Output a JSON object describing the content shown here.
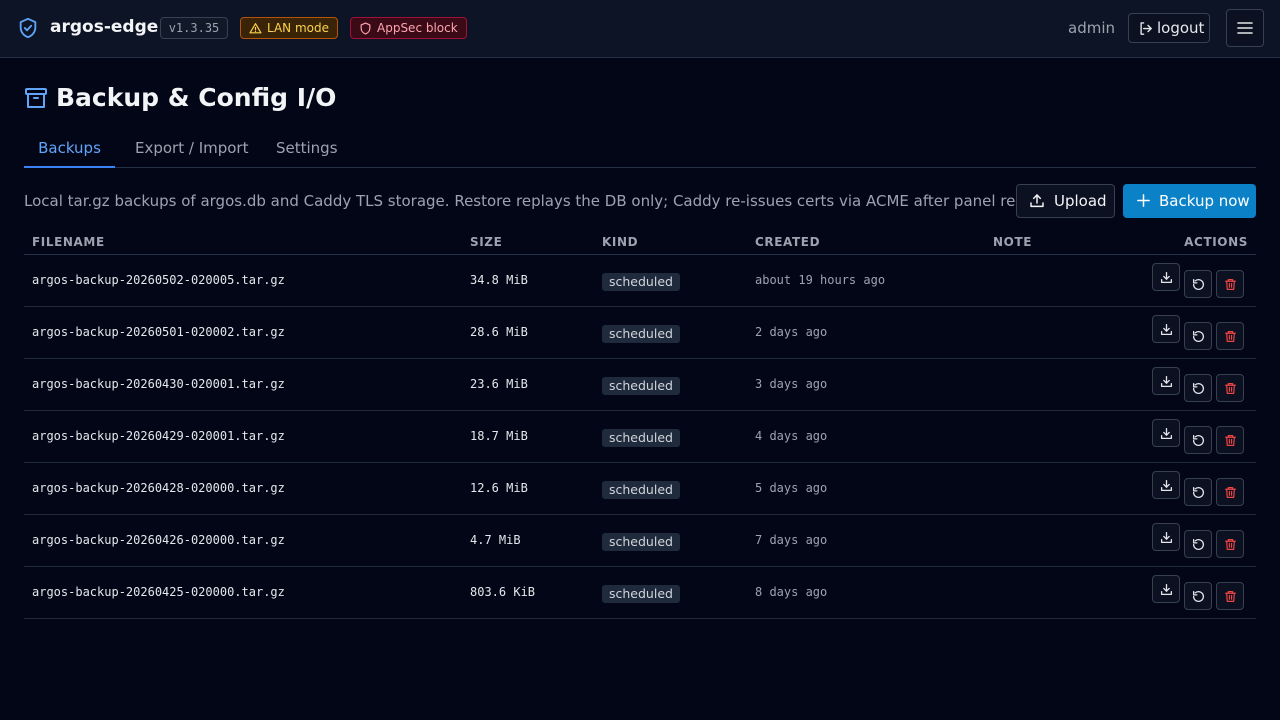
{
  "header": {
    "brand": "argos-edge",
    "version": "v1.3.35",
    "lan_badge": "LAN mode",
    "appsec_badge": "AppSec block",
    "user": "admin",
    "logout_label": "logout",
    "menu_icon": "hamburger-icon"
  },
  "page": {
    "title": "Backup & Config I/O",
    "icon": "archive-icon"
  },
  "tabs": [
    {
      "label": "Backups",
      "active": true
    },
    {
      "label": "Export / Import",
      "active": false
    },
    {
      "label": "Settings",
      "active": false
    }
  ],
  "backups": {
    "description": "Local tar.gz backups of argos.db and Caddy TLS storage. Restore replays the DB only; Caddy re-issues certs via ACME after panel restart.",
    "upload_label": "Upload",
    "backup_now_label": "Backup now",
    "columns": {
      "filename": "FILENAME",
      "size": "SIZE",
      "kind": "KIND",
      "created": "CREATED",
      "note": "NOTE",
      "actions": "ACTIONS"
    },
    "rows": [
      {
        "filename": "argos-backup-20260502-020005.tar.gz",
        "size": "34.8 MiB",
        "kind": "scheduled",
        "created": "about 19 hours ago",
        "note": ""
      },
      {
        "filename": "argos-backup-20260501-020002.tar.gz",
        "size": "28.6 MiB",
        "kind": "scheduled",
        "created": "2 days ago",
        "note": ""
      },
      {
        "filename": "argos-backup-20260430-020001.tar.gz",
        "size": "23.6 MiB",
        "kind": "scheduled",
        "created": "3 days ago",
        "note": ""
      },
      {
        "filename": "argos-backup-20260429-020001.tar.gz",
        "size": "18.7 MiB",
        "kind": "scheduled",
        "created": "4 days ago",
        "note": ""
      },
      {
        "filename": "argos-backup-20260428-020000.tar.gz",
        "size": "12.6 MiB",
        "kind": "scheduled",
        "created": "5 days ago",
        "note": ""
      },
      {
        "filename": "argos-backup-20260426-020000.tar.gz",
        "size": "4.7 MiB",
        "kind": "scheduled",
        "created": "7 days ago",
        "note": ""
      },
      {
        "filename": "argos-backup-20260425-020000.tar.gz",
        "size": "803.6 KiB",
        "kind": "scheduled",
        "created": "8 days ago",
        "note": ""
      }
    ]
  },
  "colors": {
    "background": "#030617",
    "topbar": "#0d1425",
    "accent": "#0b82c8",
    "tab_active": "#60a5fa",
    "danger_icon": "#ef4444"
  }
}
